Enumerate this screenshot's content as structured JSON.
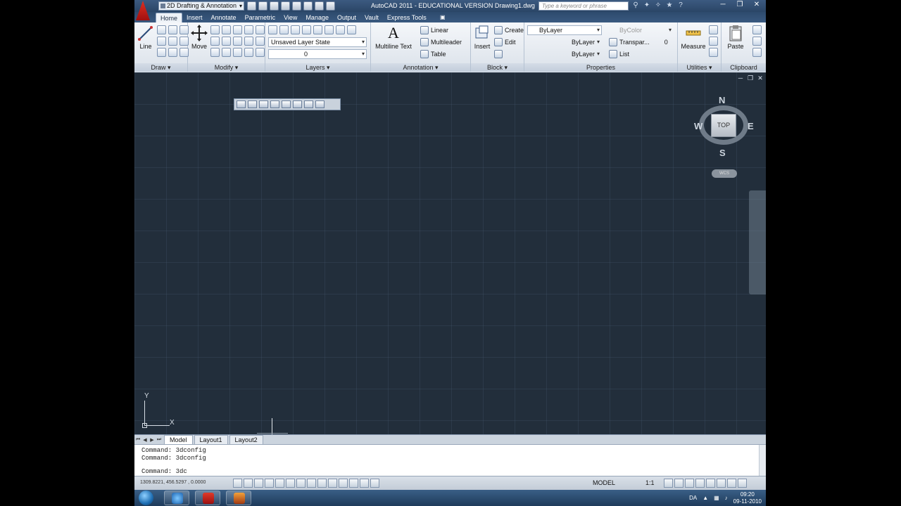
{
  "titlebar": {
    "workspace": "2D Drafting & Annotation",
    "title": "AutoCAD 2011 - EDUCATIONAL VERSION    Drawing1.dwg",
    "search_placeholder": "Type a keyword or phrase"
  },
  "ribbon_tabs": [
    "Home",
    "Insert",
    "Annotate",
    "Parametric",
    "View",
    "Manage",
    "Output",
    "Vault",
    "Express Tools"
  ],
  "panels": {
    "draw": {
      "title": "Draw ▾",
      "line_label": "Line"
    },
    "modify": {
      "title": "Modify ▾",
      "move_label": "Move"
    },
    "layers": {
      "title": "Layers ▾",
      "layer_state": "Unsaved Layer State",
      "current_layer": "0"
    },
    "annotation": {
      "title": "Annotation ▾",
      "multiline_text": "Multiline Text",
      "linear": "Linear",
      "multileader": "Multileader",
      "table": "Table"
    },
    "block": {
      "title": "Block ▾",
      "insert": "Insert",
      "create": "Create",
      "edit": "Edit"
    },
    "properties": {
      "title": "Properties",
      "color": "ByLayer",
      "linetype": "ByLayer",
      "lineweight": "ByLayer",
      "plot_style": "ByColor",
      "transparency": "Transpar...",
      "transparency_value": "0",
      "list": "List"
    },
    "utilities": {
      "title": "Utilities ▾",
      "measure": "Measure"
    },
    "clipboard": {
      "title": "Clipboard",
      "paste": "Paste"
    }
  },
  "viewcube": {
    "north": "N",
    "south": "S",
    "east": "E",
    "west": "W",
    "face": "TOP",
    "wcs": "WCS"
  },
  "ucs": {
    "x": "X",
    "y": "Y"
  },
  "layout_tabs": [
    "Model",
    "Layout1",
    "Layout2"
  ],
  "command_history": [
    "Command: 3dconfig",
    "Command: 3dconfig"
  ],
  "command_input": "Command: 3dc",
  "status": {
    "coords": "1309.8221, 456.5297 , 0.0000",
    "model": "MODEL",
    "anno_scale": "1:1"
  },
  "tray": {
    "lang": "DA",
    "time": "09:20",
    "date": "09-11-2010"
  },
  "colors": {
    "viewport_bg": "#222e3b",
    "titlebar": "#2a4566",
    "app_logo": "#d02418"
  }
}
